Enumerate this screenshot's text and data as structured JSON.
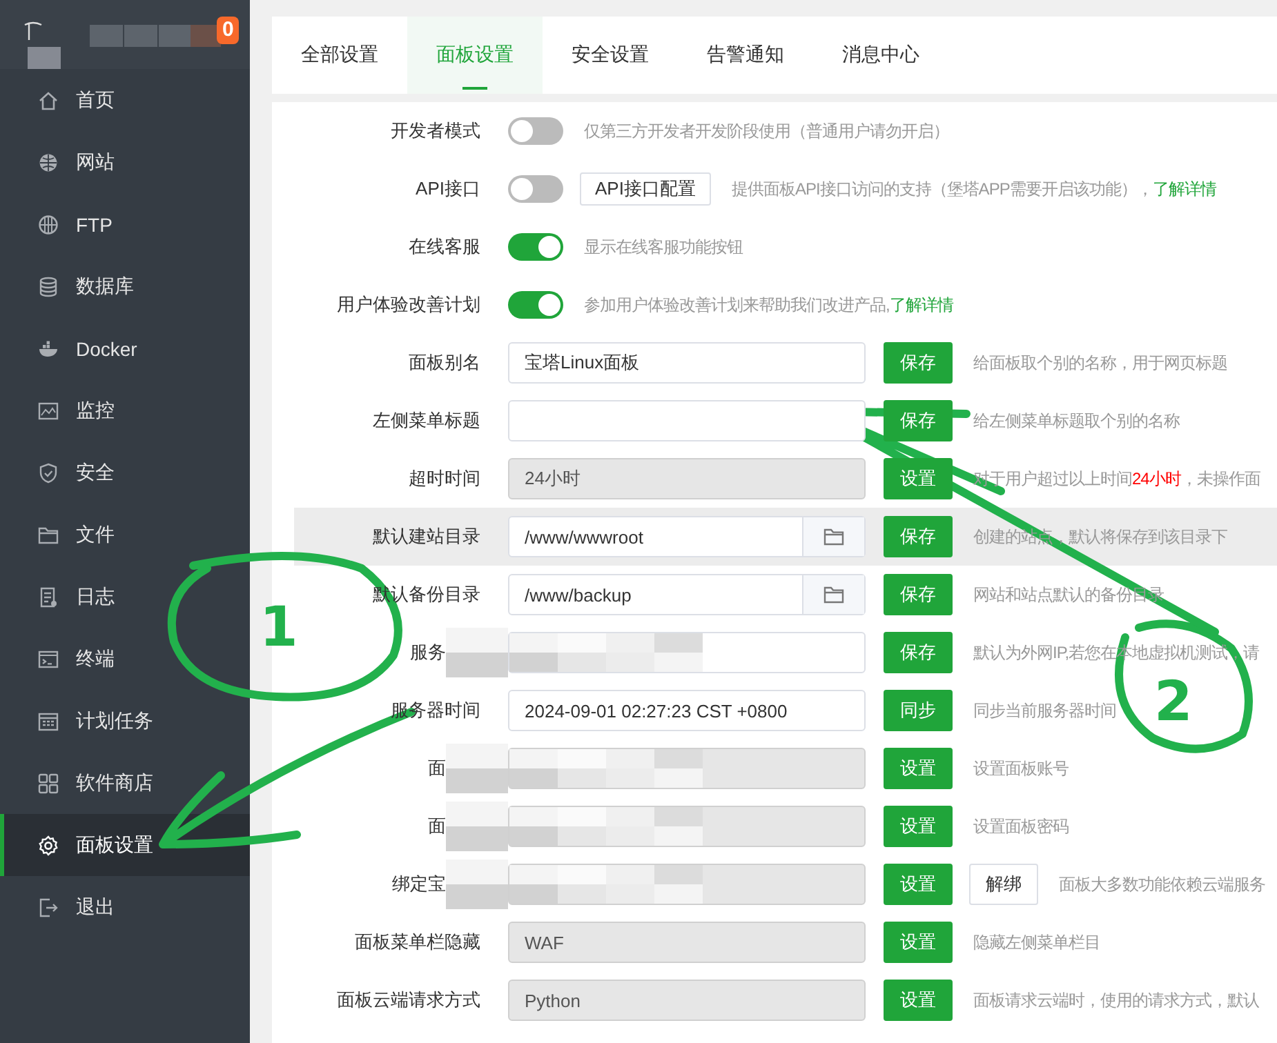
{
  "sidebar": {
    "badge": "0",
    "items": [
      {
        "label": "首页",
        "selected": false
      },
      {
        "label": "网站",
        "selected": false
      },
      {
        "label": "FTP",
        "selected": false
      },
      {
        "label": "数据库",
        "selected": false
      },
      {
        "label": "Docker",
        "selected": false
      },
      {
        "label": "监控",
        "selected": false
      },
      {
        "label": "安全",
        "selected": false
      },
      {
        "label": "文件",
        "selected": false
      },
      {
        "label": "日志",
        "selected": false
      },
      {
        "label": "终端",
        "selected": false
      },
      {
        "label": "计划任务",
        "selected": false
      },
      {
        "label": "软件商店",
        "selected": false
      },
      {
        "label": "面板设置",
        "selected": true
      },
      {
        "label": "退出",
        "selected": false
      }
    ]
  },
  "tabs": [
    {
      "label": "全部设置",
      "selected": false
    },
    {
      "label": "面板设置",
      "selected": true
    },
    {
      "label": "安全设置",
      "selected": false
    },
    {
      "label": "告警通知",
      "selected": false
    },
    {
      "label": "消息中心",
      "selected": false
    }
  ],
  "settings": [
    {
      "kind": "toggle",
      "label": "开发者模式",
      "on": false,
      "description": [
        {
          "kind": "plain",
          "text": "仅第三方开发者开发阶段使用（普通用户请勿开启）"
        }
      ]
    },
    {
      "kind": "toggle",
      "label": "API接口",
      "on": false,
      "extra_button": "API接口配置",
      "description": [
        {
          "kind": "plain",
          "text": "提供面板API接口访问的支持（堡塔APP需要开启该功能），"
        },
        {
          "kind": "link",
          "text": "了解详情"
        }
      ]
    },
    {
      "kind": "toggle",
      "label": "在线客服",
      "on": true,
      "description": [
        {
          "kind": "plain",
          "text": "显示在线客服功能按钮"
        }
      ]
    },
    {
      "kind": "toggle",
      "label": "用户体验改善计划",
      "on": true,
      "description": [
        {
          "kind": "plain",
          "text": "参加用户体验改善计划来帮助我们改进产品,"
        },
        {
          "kind": "link",
          "text": "了解详情"
        }
      ]
    },
    {
      "kind": "input",
      "label": "面板别名",
      "value": "宝塔Linux面板",
      "readonly": false,
      "button": "保存",
      "description": [
        {
          "kind": "plain",
          "text": "给面板取个别的名称，用于网页标题"
        }
      ]
    },
    {
      "kind": "input",
      "label": "左侧菜单标题",
      "readonly": false,
      "button": "保存",
      "description": [
        {
          "kind": "plain",
          "text": "给左侧菜单标题取个别的名称"
        }
      ]
    },
    {
      "kind": "input",
      "label": "超时时间",
      "value": "24小时",
      "readonly": true,
      "button": "设置",
      "description": [
        {
          "kind": "plain",
          "text": "对于用户超过以上时间"
        },
        {
          "kind": "red",
          "text": "24小时"
        },
        {
          "kind": "plain",
          "text": "，未操作面"
        }
      ]
    },
    {
      "kind": "input",
      "label": "默认建站目录",
      "value": "/www/wwwroot",
      "readonly": false,
      "browse": true,
      "highlighted": true,
      "button": "保存",
      "description": [
        {
          "kind": "plain",
          "text": "创建的站点，默认将保存到该目录下"
        }
      ]
    },
    {
      "kind": "input",
      "label": "默认备份目录",
      "value": "/www/backup",
      "readonly": false,
      "browse": true,
      "button": "保存",
      "description": [
        {
          "kind": "plain",
          "text": "网站和站点默认的备份目录"
        }
      ]
    },
    {
      "kind": "input",
      "label": "服务",
      "readonly": false,
      "redacted": true,
      "button": "保存",
      "description": [
        {
          "kind": "plain",
          "text": "默认为外网IP,若您在本地虚拟机测试，请"
        }
      ]
    },
    {
      "kind": "input",
      "label": "服务器时间",
      "value": "2024-09-01 02:27:23 CST +0800",
      "readonly": false,
      "button": "同步",
      "description": [
        {
          "kind": "plain",
          "text": "同步当前服务器时间"
        }
      ]
    },
    {
      "kind": "input",
      "label": "面",
      "readonly": true,
      "redacted": true,
      "button": "设置",
      "description": [
        {
          "kind": "plain",
          "text": "设置面板账号"
        }
      ]
    },
    {
      "kind": "input",
      "label": "面",
      "readonly": true,
      "redacted": true,
      "button": "设置",
      "description": [
        {
          "kind": "plain",
          "text": "设置面板密码"
        }
      ]
    },
    {
      "kind": "input",
      "label": "绑定宝",
      "readonly": true,
      "redacted": true,
      "button": "设置",
      "extra_button": "解绑",
      "description": [
        {
          "kind": "plain",
          "text": "面板大多数功能依赖云端服务"
        }
      ]
    },
    {
      "kind": "input",
      "label": "面板菜单栏隐藏",
      "value": "WAF",
      "readonly": true,
      "button": "设置",
      "description": [
        {
          "kind": "plain",
          "text": "隐藏左侧菜单栏目"
        }
      ]
    },
    {
      "kind": "input",
      "label": "面板云端请求方式",
      "value": "Python",
      "readonly": true,
      "button": "设置",
      "description": [
        {
          "kind": "plain",
          "text": "面板请求云端时，使用的请求方式，默认"
        }
      ]
    }
  ],
  "annotations": [
    {
      "label": "1"
    },
    {
      "label": "2"
    }
  ]
}
